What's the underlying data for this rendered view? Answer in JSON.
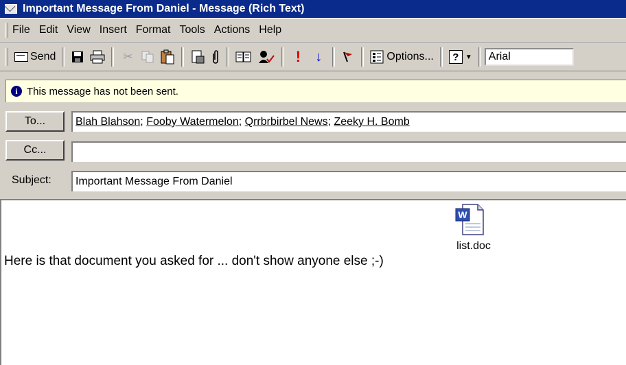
{
  "window": {
    "title": "Important Message From Daniel - Message (Rich Text)"
  },
  "menu": {
    "items": [
      "File",
      "Edit",
      "View",
      "Insert",
      "Format",
      "Tools",
      "Actions",
      "Help"
    ]
  },
  "toolbar": {
    "send_label": "Send",
    "options_label": "Options...",
    "font_value": "Arial",
    "icons": [
      "save-icon",
      "print-icon",
      "cut-icon",
      "copy-icon",
      "paste-icon",
      "insert-file-icon",
      "attach-icon",
      "address-book-icon",
      "check-names-icon",
      "importance-high-icon",
      "importance-low-icon",
      "flag-icon",
      "options-icon",
      "help-icon"
    ]
  },
  "infobar": {
    "text": "This message has not been sent."
  },
  "header": {
    "to_button": "To...",
    "cc_button": "Cc...",
    "subject_label": "Subject:",
    "recipients": [
      "Blah Blahson",
      "Fooby Watermelon",
      "Qrrbrbirbel News",
      "Zeeky H. Bomb"
    ],
    "cc_value": "",
    "subject_value": "Important Message From Daniel"
  },
  "body": {
    "text": "Here is that document you asked for ... don't show anyone else ;-)",
    "attachment_name": "list.doc"
  },
  "colors": {
    "titlebar": "#0a2a8c",
    "infobar": "#ffffe1",
    "chrome": "#d4d0c8",
    "importance_high": "#e00000",
    "importance_low": "#0000c0"
  }
}
